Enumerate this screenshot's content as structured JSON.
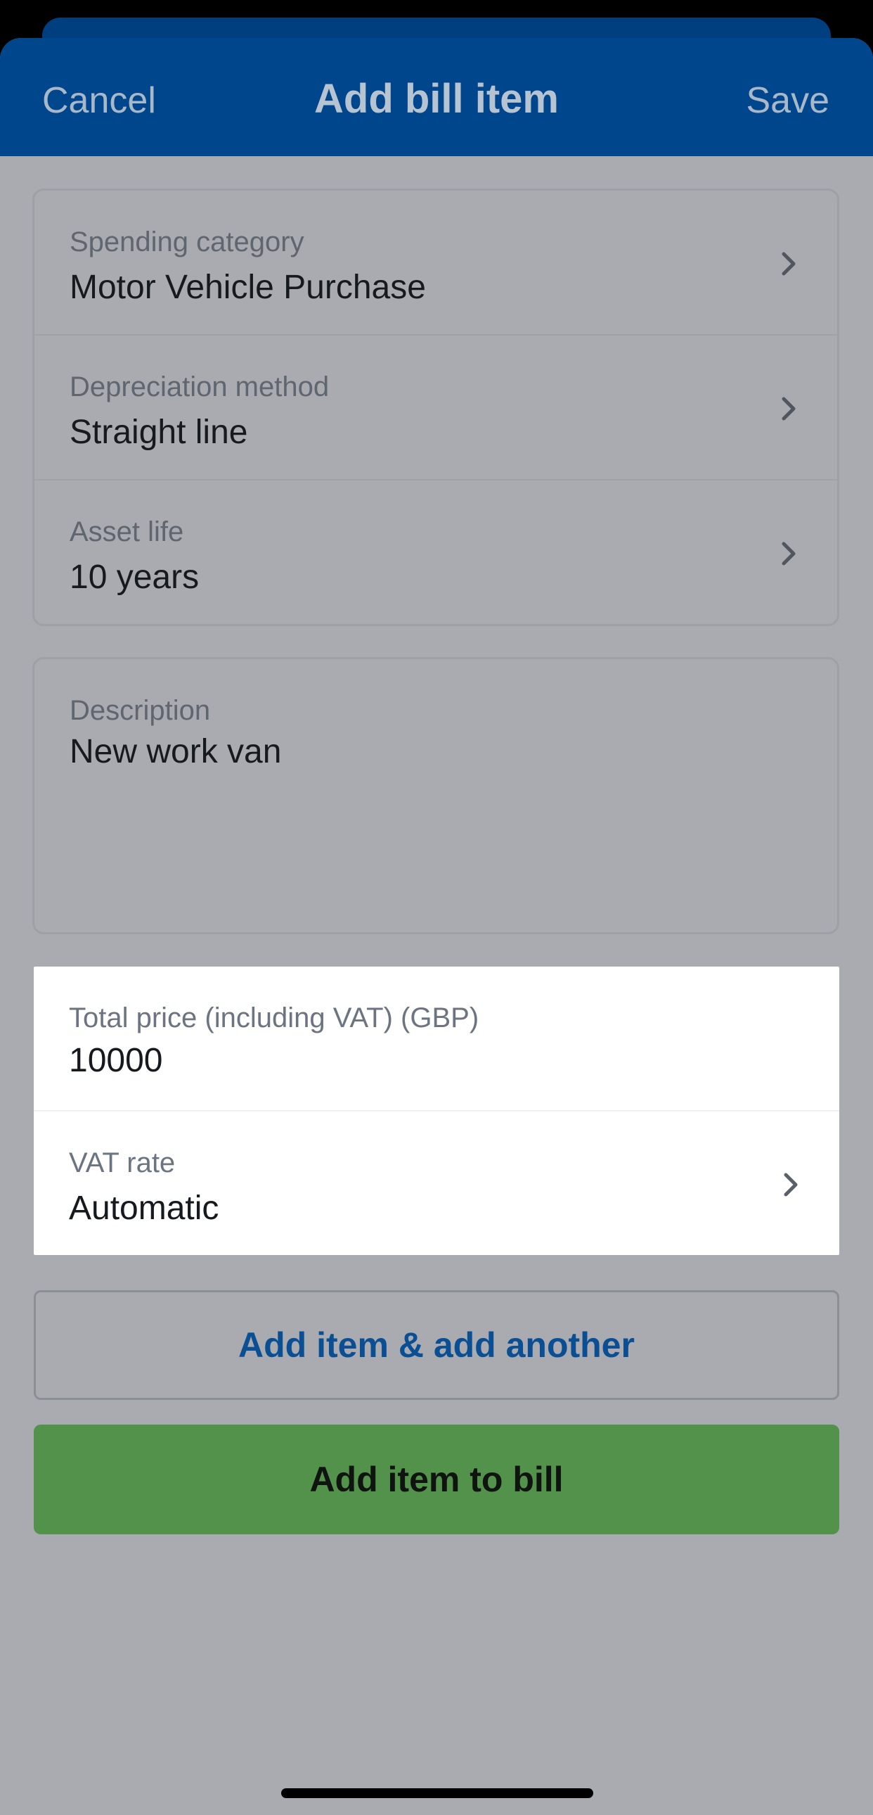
{
  "nav": {
    "cancel_label": "Cancel",
    "title": "Add bill item",
    "save_label": "Save"
  },
  "fields": [
    {
      "label": "Spending category",
      "value": "Motor Vehicle Purchase",
      "icon": "chevron-right-icon"
    },
    {
      "label": "Depreciation method",
      "value": "Straight line",
      "icon": "chevron-right-icon"
    },
    {
      "label": "Asset life",
      "value": "10 years",
      "icon": "chevron-right-icon"
    }
  ],
  "description": {
    "label": "Description",
    "value": "New work van"
  },
  "price": {
    "total_label": "Total price (including VAT) (GBP)",
    "total_value": "10000",
    "vat_label": "VAT rate",
    "vat_value": "Automatic"
  },
  "buttons": {
    "add_another_label": "Add item & add another",
    "add_to_bill_label": "Add item to bill"
  },
  "colors": {
    "navbar": "#00468d",
    "primary_button": "#53924a",
    "secondary_text": "#0a4f93",
    "overlay_background": "#a9abb0"
  }
}
